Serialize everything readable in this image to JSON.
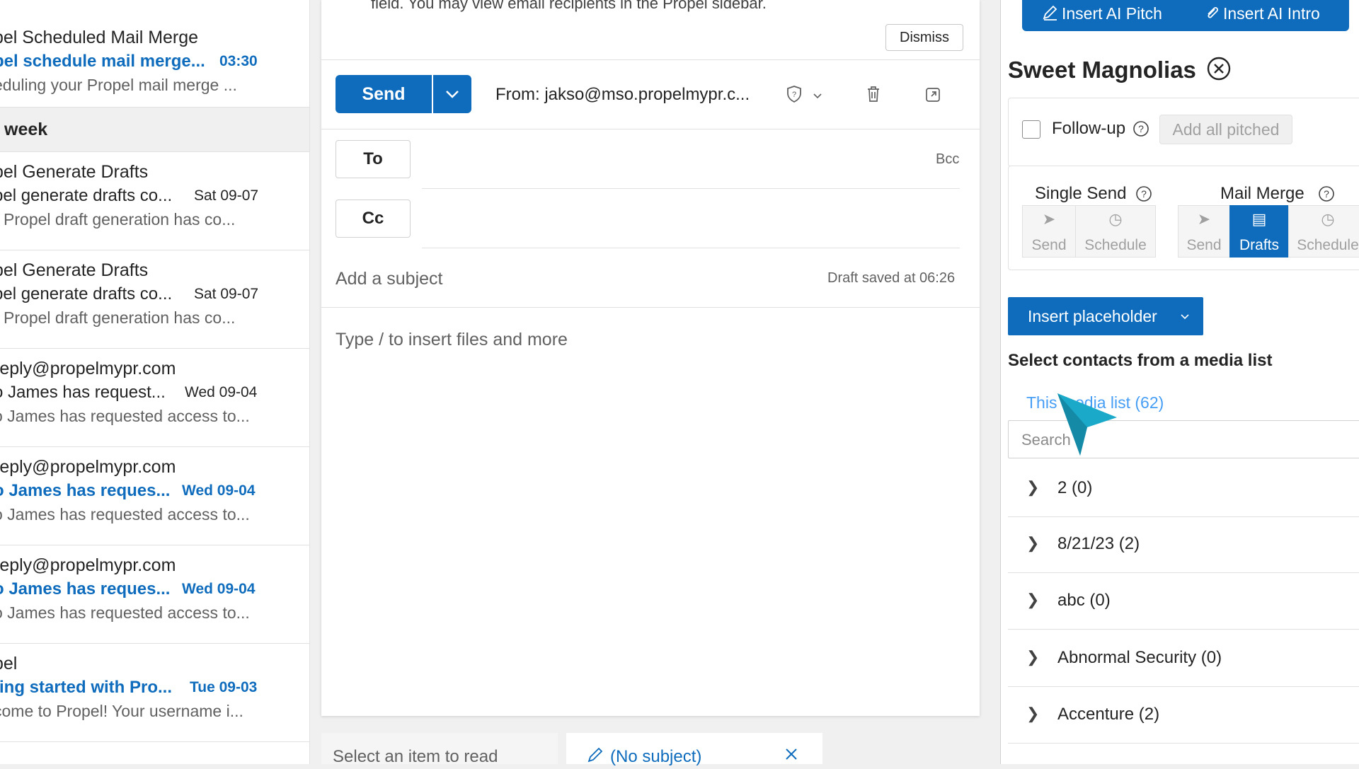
{
  "mail_list": {
    "items": [
      {
        "sender": "pel Scheduled Mail Merge",
        "subject": "pel schedule mail merge...",
        "date": "03:30",
        "preview": "eduling your Propel mail merge ...",
        "unread": true
      },
      {
        "sender": "pel Generate Drafts",
        "subject": "pel generate drafts co...",
        "date": "Sat 09-07",
        "preview": "r Propel draft generation has co...",
        "unread": false
      },
      {
        "sender": "pel Generate Drafts",
        "subject": "pel generate drafts co...",
        "date": "Sat 09-07",
        "preview": "r Propel draft generation has co...",
        "unread": false
      },
      {
        "sender": "reply@propelmypr.com",
        "subject": "o James has request...",
        "date": "Wed 09-04",
        "preview": "o James has requested access to...",
        "unread": false
      },
      {
        "sender": "reply@propelmypr.com",
        "subject": "o James has reques...",
        "date": "Wed 09-04",
        "preview": "o James has requested access to...",
        "unread": true
      },
      {
        "sender": "reply@propelmypr.com",
        "subject": "o James has reques...",
        "date": "Wed 09-04",
        "preview": "o James has requested access to...",
        "unread": true
      },
      {
        "sender": "pel",
        "subject": "ting started with Pro...",
        "date": "Tue 09-03",
        "preview": "come to Propel! Your username i...",
        "unread": true
      }
    ],
    "group_header": "week"
  },
  "compose": {
    "notice": "field. You may view email recipients in the Propel sidebar.",
    "dismiss_label": "Dismiss",
    "send_label": "Send",
    "from_text": "From: jakso@mso.propelmypr.c...",
    "to_label": "To",
    "cc_label": "Cc",
    "bcc_label": "Bcc",
    "subject_placeholder": "Add a subject",
    "draft_saved": "Draft saved at 06:26",
    "body_placeholder": "Type / to insert files and more"
  },
  "bottom_tabs": {
    "reading": "Select an item to read",
    "draft": "(No subject)"
  },
  "propel": {
    "ai_pitch": "Insert AI Pitch",
    "ai_intro": "Insert AI Intro",
    "title": "Sweet Magnolias",
    "follow_up": "Follow-up",
    "add_all_pitched": "Add all pitched",
    "single_send": "Single Send",
    "mail_merge": "Mail Merge",
    "single_send_buttons": [
      "Send",
      "Schedule"
    ],
    "mail_merge_buttons": [
      "Send",
      "Drafts",
      "Schedule"
    ],
    "insert_placeholder": "Insert placeholder",
    "select_contacts": "Select contacts from a media list",
    "media_list_link": "This media list (62)",
    "search_placeholder": "Search",
    "lists": [
      "2 (0)",
      "8/21/23 (2)",
      "abc (0)",
      "Abnormal Security (0)",
      "Accenture (2)"
    ]
  },
  "colors": {
    "accent": "#0f6cbd",
    "link": "#479ef5",
    "cursor": "#1ba9c9"
  }
}
